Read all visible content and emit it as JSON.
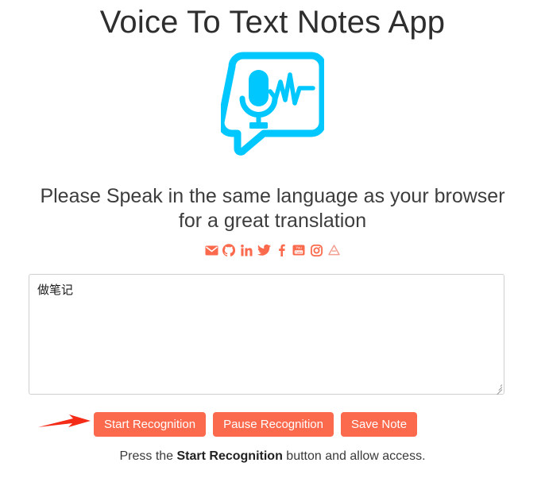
{
  "app": {
    "title": "Voice To Text Notes App",
    "subtitle": "Please Speak in the same language as your browser for a great translation",
    "logo_icon": "microphone-speech-bubble-icon",
    "accent_color": "#00c8ff",
    "button_color": "#fb6a4d",
    "annotation_arrow_color": "#f42b17"
  },
  "social": {
    "items": [
      {
        "name": "email-icon",
        "label": "Email"
      },
      {
        "name": "github-icon",
        "label": "GitHub"
      },
      {
        "name": "linkedin-icon",
        "label": "LinkedIn"
      },
      {
        "name": "twitter-icon",
        "label": "Twitter"
      },
      {
        "name": "facebook-icon",
        "label": "Facebook"
      },
      {
        "name": "youtube-icon",
        "label": "YouTube"
      },
      {
        "name": "instagram-icon",
        "label": "Instagram"
      },
      {
        "name": "google-drive-icon",
        "label": "Google Drive"
      }
    ]
  },
  "notes": {
    "value": "做笔记",
    "placeholder": ""
  },
  "buttons": {
    "start": "Start Recognition",
    "pause": "Pause Recognition",
    "save": "Save Note"
  },
  "footer": {
    "prefix": "Press the ",
    "emphasis": "Start Recognition",
    "suffix": " button and allow access."
  }
}
